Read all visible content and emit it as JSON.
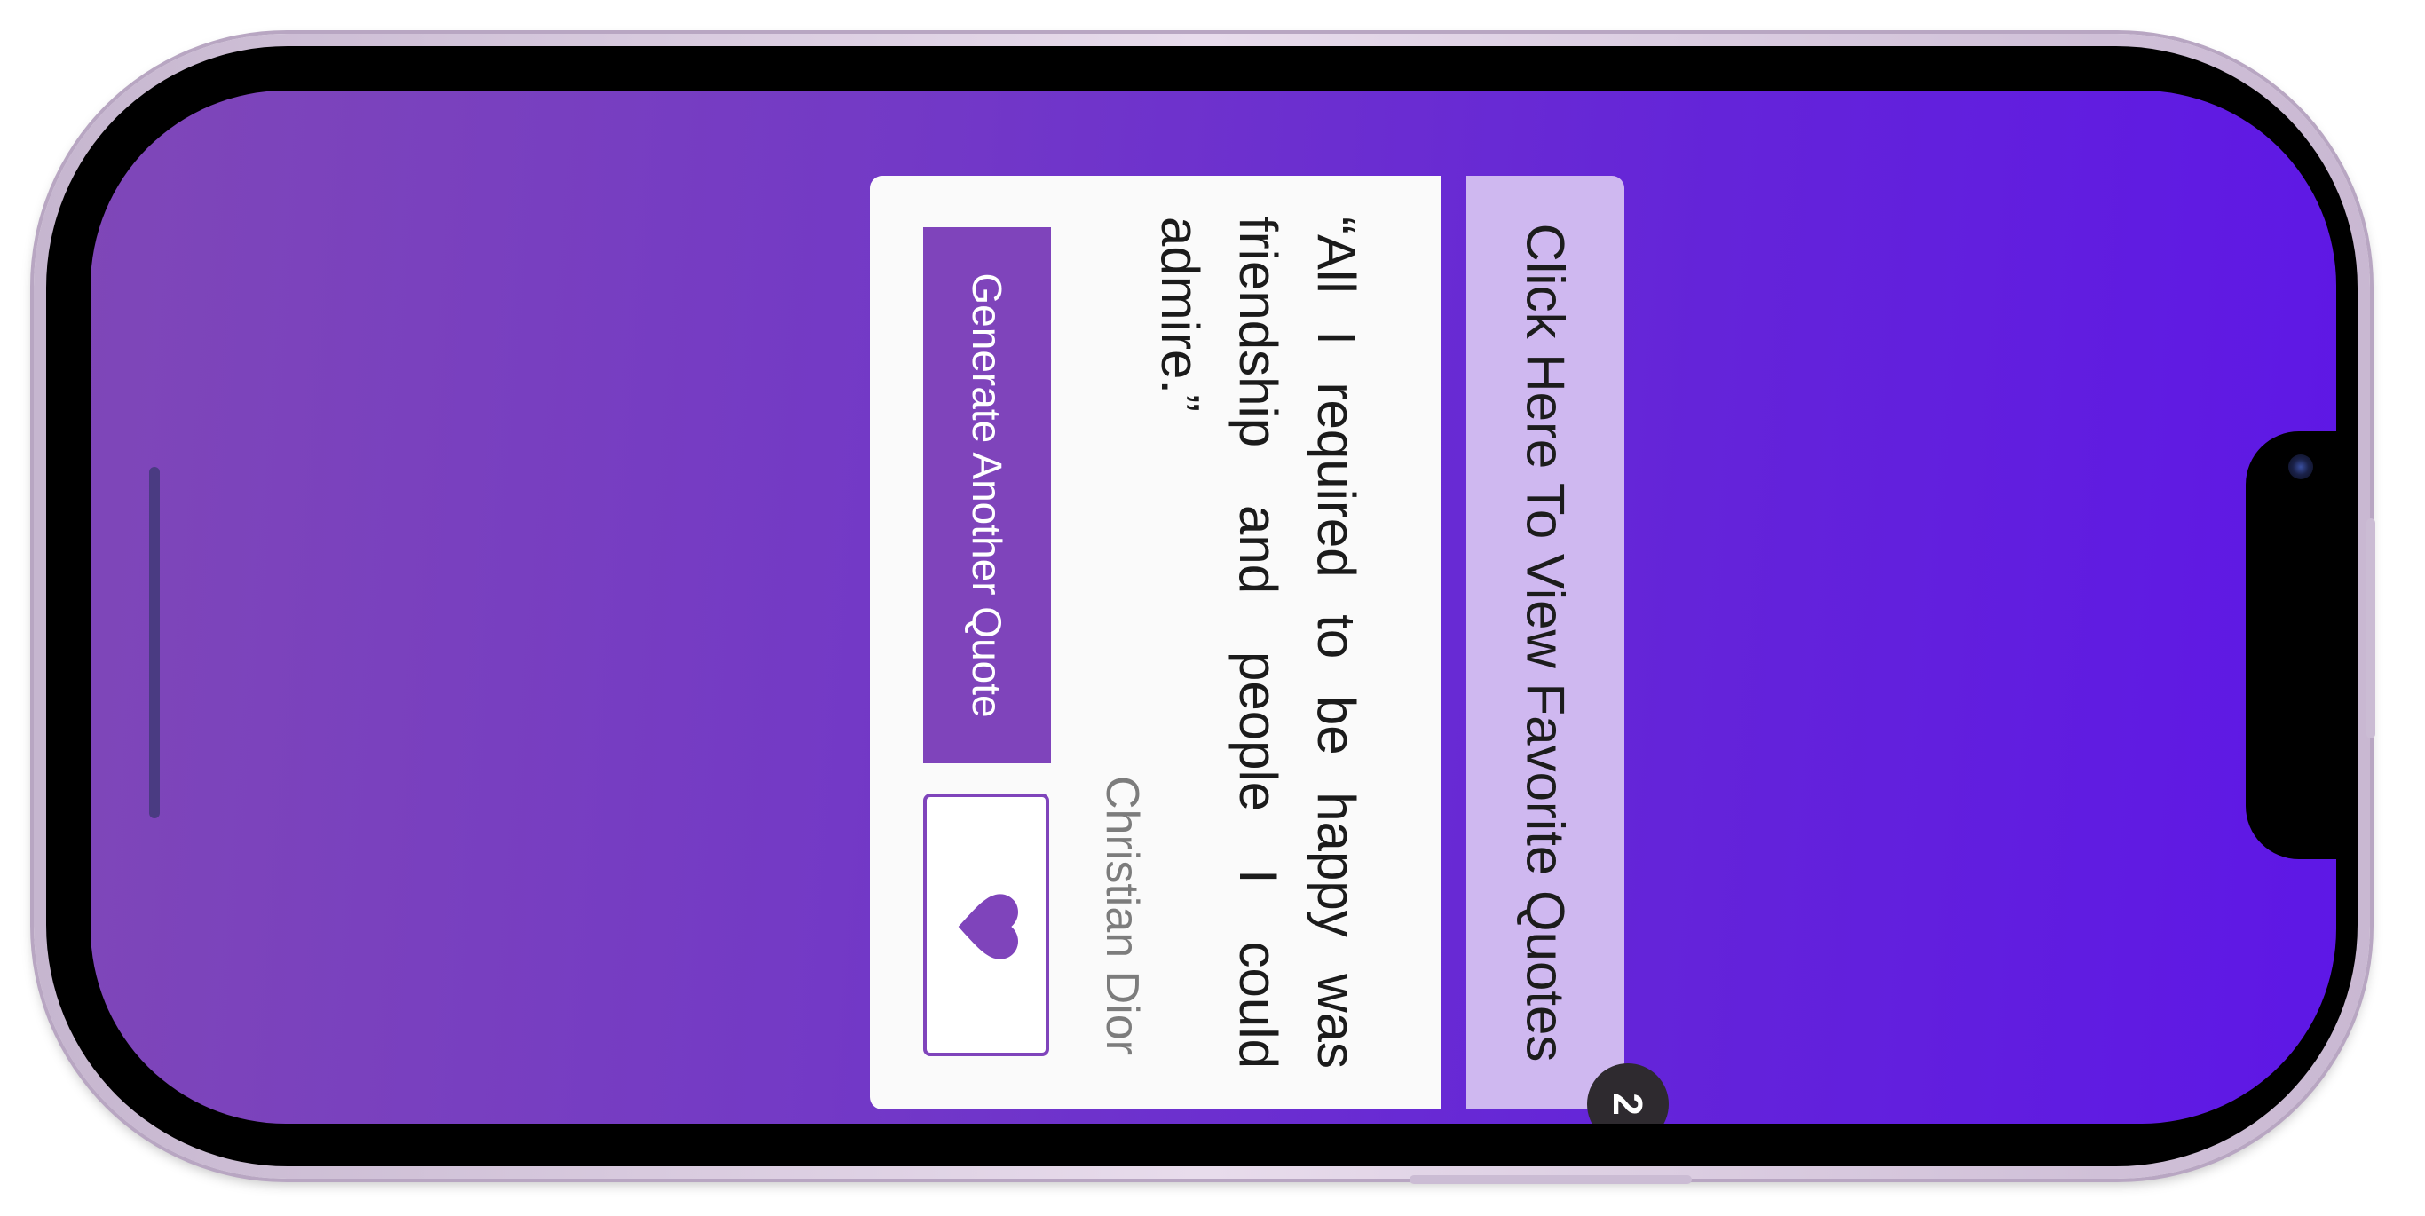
{
  "favorites": {
    "label": "Click Here To View Favorite Quotes",
    "count_badge": "2"
  },
  "quote": {
    "text": "“All I required to be happy was friendship and people I could admire.”",
    "author": "Christian Dior"
  },
  "actions": {
    "generate_label": "Generate Another Quote",
    "favorite_icon": "heart-icon"
  },
  "colors": {
    "accent": "#7f44bb",
    "panel": "#cfb8f0",
    "background_start": "#7f47b8",
    "background_end": "#5e17e6"
  }
}
